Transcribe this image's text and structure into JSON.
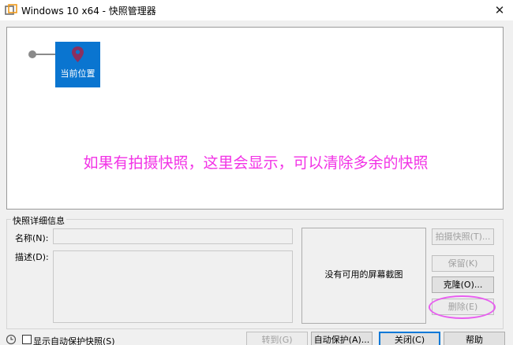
{
  "window": {
    "title": "Windows 10 x64 - 快照管理器",
    "close_glyph": "✕"
  },
  "tree": {
    "current_node_label": "当前位置",
    "annotation": "如果有拍摄快照，这里会显示，可以清除多余的快照"
  },
  "details": {
    "group_title": "快照详细信息",
    "name_label": "名称(N):",
    "name_value": "",
    "description_label": "描述(D):",
    "description_value": "",
    "screenshot_placeholder": "没有可用的屏幕截图"
  },
  "buttons": {
    "take_snapshot": "拍摄快照(T)...",
    "keep": "保留(K)",
    "clone": "克隆(O)...",
    "delete": "删除(E)",
    "goto": "转到(G)",
    "autoprotect": "自动保护(A)...",
    "close": "关闭(C)",
    "help": "帮助"
  },
  "footer": {
    "show_autoprotect_label": "显示自动保护快照(S)",
    "show_autoprotect_checked": false
  },
  "colors": {
    "node_blue": "#0a75d0",
    "annotation_magenta": "#f233e6",
    "default_button_border": "#0078d7"
  },
  "icons": [
    "vmware-app-icon",
    "close-icon",
    "location-pin-icon",
    "clock-icon",
    "checkbox"
  ]
}
